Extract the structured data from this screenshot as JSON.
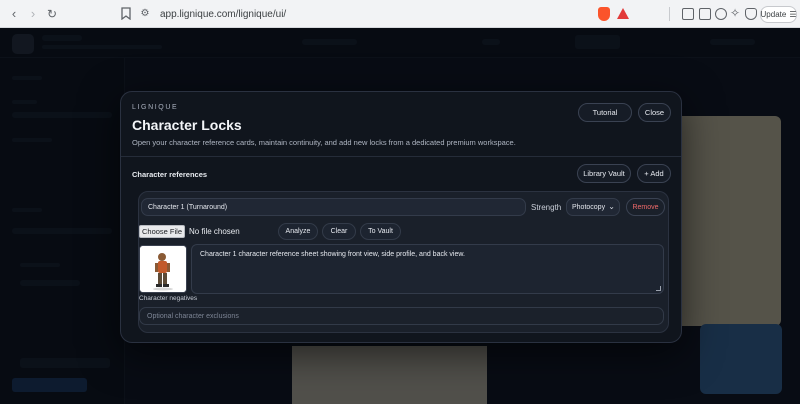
{
  "browser": {
    "url": "app.lignique.com/lignique/ui/",
    "update_label": "Update"
  },
  "modal": {
    "eyebrow": "LIGNIQUE",
    "title": "Character Locks",
    "subtitle": "Open your character reference cards, maintain continuity, and add new locks from a dedicated premium workspace.",
    "tutorial_label": "Tutorial",
    "close_label": "Close",
    "section_label": "Character references",
    "library_vault_label": "Library Vault",
    "add_label": "+ Add"
  },
  "character": {
    "name": "Character 1 (Turnaround)",
    "strength_label": "Strength",
    "strength_value": "Photocopy",
    "remove_label": "Remove",
    "choose_file_label": "Choose File",
    "file_status": "No file chosen",
    "analyze_label": "Analyze",
    "clear_label": "Clear",
    "to_vault_label": "To Vault",
    "description": "Character 1 character reference sheet showing front view, side profile, and back view.",
    "negatives_label": "Character negatives",
    "negatives_placeholder": "Optional character exclusions"
  },
  "icons": {
    "back": "arrow-left-icon",
    "forward": "arrow-right-icon",
    "reload": "reload-icon",
    "bookmark": "bookmark-icon",
    "site": "site-settings-icon",
    "brave": "brave-shield-icon",
    "rewards": "triangle-rewards-icon",
    "menu": "hamburger-menu-icon"
  }
}
